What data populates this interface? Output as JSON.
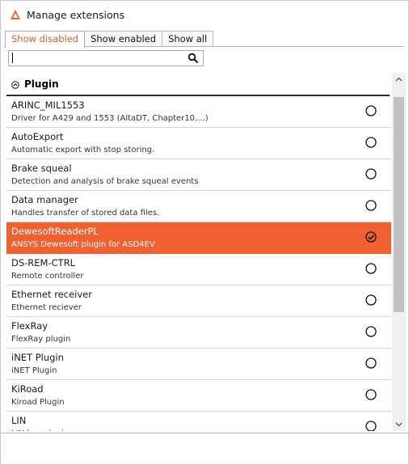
{
  "window": {
    "title": "Manage extensions",
    "icon": "dewesoft-logo-icon"
  },
  "tabs": [
    {
      "label": "Show disabled",
      "active": true
    },
    {
      "label": "Show enabled",
      "active": false
    },
    {
      "label": "Show all",
      "active": false
    }
  ],
  "search": {
    "value": "",
    "placeholder": ""
  },
  "section": {
    "label": "Plugin",
    "expanded": true
  },
  "items": [
    {
      "name": "ARINC_MIL1553",
      "description": "Driver for A429 and 1553 (AltaDT, Chapter10,...)",
      "checked": false
    },
    {
      "name": "AutoExport",
      "description": "Automatic export with stop storing.",
      "checked": false
    },
    {
      "name": "Brake squeal",
      "description": "Detection and analysis of brake squeal events",
      "checked": false
    },
    {
      "name": "Data manager",
      "description": "Handles transfer of stored data files.",
      "checked": false
    },
    {
      "name": "DewesoftReaderPL",
      "description": "ANSYS Dewesoft plugin for ASD4EV",
      "checked": true
    },
    {
      "name": "DS-REM-CTRL",
      "description": "Remote controller",
      "checked": false
    },
    {
      "name": "Ethernet receiver",
      "description": "Ethernet reciever",
      "checked": false
    },
    {
      "name": "FlexRay",
      "description": "FlexRay plugin",
      "checked": false
    },
    {
      "name": "iNET Plugin",
      "description": "iNET Plugin",
      "checked": false
    },
    {
      "name": "KiRoad",
      "description": "Kiroad Plugin",
      "checked": false
    },
    {
      "name": "LIN",
      "description": "LIN bus plugin",
      "checked": false
    }
  ],
  "colors": {
    "accent": "#f06030",
    "tab_active_text": "#e85a28"
  }
}
